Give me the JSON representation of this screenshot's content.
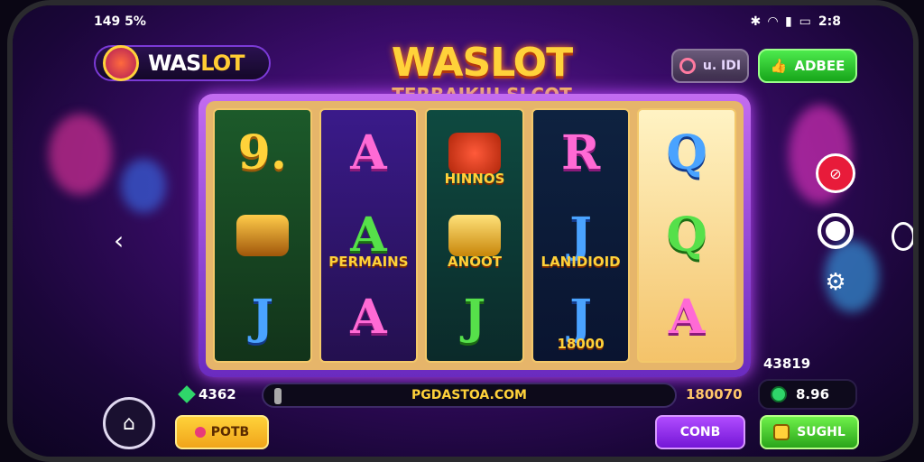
{
  "status": {
    "left": "149 5%",
    "time": "2:8"
  },
  "header": {
    "brand_main": "WAS",
    "brand_accent": "LOT",
    "game_title": "WASLOT",
    "game_subtitle": "TERBAIKIU SLCOT"
  },
  "top_buttons": {
    "gray_label": "u. IDI",
    "green_label": "ADBEE"
  },
  "reels": [
    [
      {
        "symbol": "9.",
        "color": "gold",
        "caption": ""
      },
      {
        "symbol": "",
        "color": "gold",
        "caption": "",
        "icon": "treasure-chest-icon"
      },
      {
        "symbol": "J",
        "color": "blue",
        "caption": ""
      }
    ],
    [
      {
        "symbol": "A",
        "color": "pink",
        "caption": ""
      },
      {
        "symbol": "A",
        "color": "green",
        "caption": "PERMAINS"
      },
      {
        "symbol": "A",
        "color": "pink",
        "caption": ""
      }
    ],
    [
      {
        "symbol": "",
        "color": "gold",
        "caption": "HINNOS",
        "icon": "gem-crown-icon"
      },
      {
        "symbol": "",
        "color": "gold",
        "caption": "ANOOT",
        "icon": "gold-bar-icon"
      },
      {
        "symbol": "J",
        "color": "green",
        "caption": ""
      }
    ],
    [
      {
        "symbol": "R",
        "color": "pink",
        "caption": ""
      },
      {
        "symbol": "J",
        "color": "blue",
        "caption": "LANIDIOID"
      },
      {
        "symbol": "J",
        "color": "blue",
        "caption": "18000"
      }
    ],
    [
      {
        "symbol": "Q",
        "color": "blue",
        "caption": ""
      },
      {
        "symbol": "Q",
        "color": "green",
        "caption": ""
      },
      {
        "symbol": "A",
        "color": "pink",
        "caption": ""
      }
    ]
  ],
  "info": {
    "balance": "4362",
    "url": "PGDASTOA.COM",
    "win": "180070",
    "stat": "43819",
    "coins": "8.96"
  },
  "bottom": {
    "bet_label": "POTB",
    "purple_label": "CONB",
    "spin_label": "SUGHL"
  }
}
